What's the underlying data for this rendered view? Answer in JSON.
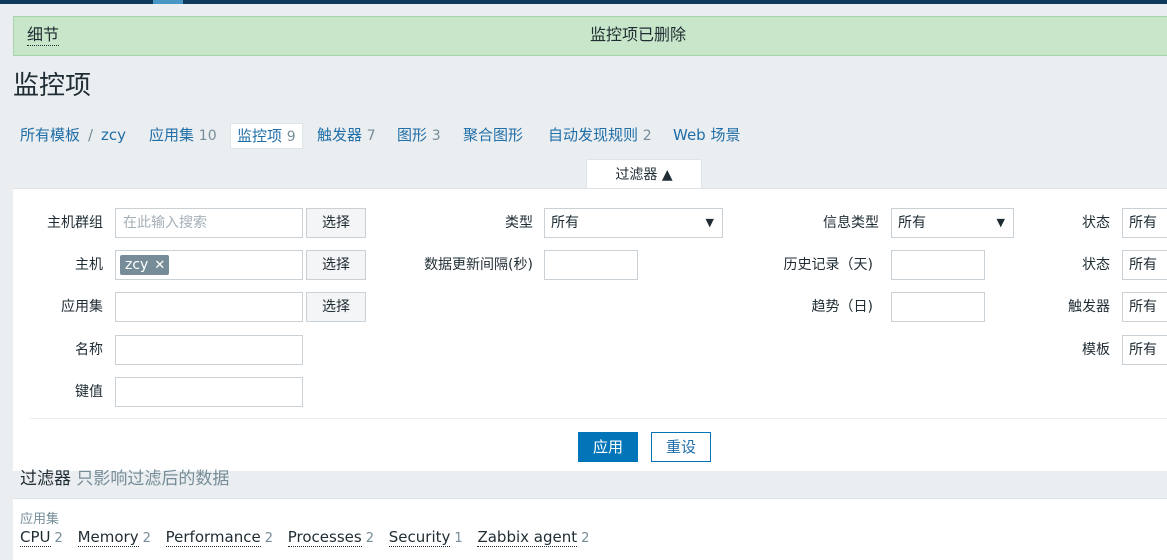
{
  "message": {
    "details_label": "细节",
    "text": "监控项已删除"
  },
  "page_title": "监控项",
  "nav": {
    "all_templates": "所有模板",
    "separator": "/",
    "template": "zcy",
    "items": [
      {
        "label": "应用集",
        "count": "10"
      },
      {
        "label": "监控项",
        "count": "9"
      },
      {
        "label": "触发器",
        "count": "7"
      },
      {
        "label": "图形",
        "count": "3"
      },
      {
        "label": "聚合图形",
        "count": ""
      },
      {
        "label": "自动发现规则",
        "count": "2"
      },
      {
        "label": "Web 场景",
        "count": ""
      }
    ]
  },
  "filter": {
    "tab_label": "过滤器 ▲",
    "host_groups": {
      "label": "主机群组",
      "placeholder": "在此输入搜索",
      "select": "选择"
    },
    "hosts": {
      "label": "主机",
      "tag": "zcy",
      "select": "选择"
    },
    "applications": {
      "label": "应用集",
      "select": "选择"
    },
    "name": {
      "label": "名称"
    },
    "key": {
      "label": "键值"
    },
    "type": {
      "label": "类型",
      "value": "所有"
    },
    "update_interval": {
      "label": "数据更新间隔(秒)"
    },
    "info_type": {
      "label": "信息类型",
      "value": "所有"
    },
    "history": {
      "label": "历史记录（天)"
    },
    "trends": {
      "label": "趋势（日)"
    },
    "state": {
      "label": "状态",
      "value": "所有"
    },
    "status": {
      "label": "状态",
      "value": "所有"
    },
    "triggers": {
      "label": "触发器",
      "value": "所有"
    },
    "template": {
      "label": "模板",
      "value": "所有"
    },
    "apply": "应用",
    "reset": "重设"
  },
  "subfilter": {
    "title": "过滤器",
    "hint": "只影响过滤后的数据",
    "group_label": "应用集",
    "items": [
      {
        "label": "CPU",
        "count": "2"
      },
      {
        "label": "Memory",
        "count": "2"
      },
      {
        "label": "Performance",
        "count": "2"
      },
      {
        "label": "Processes",
        "count": "2"
      },
      {
        "label": "Security",
        "count": "1"
      },
      {
        "label": "Zabbix agent",
        "count": "2"
      }
    ]
  }
}
